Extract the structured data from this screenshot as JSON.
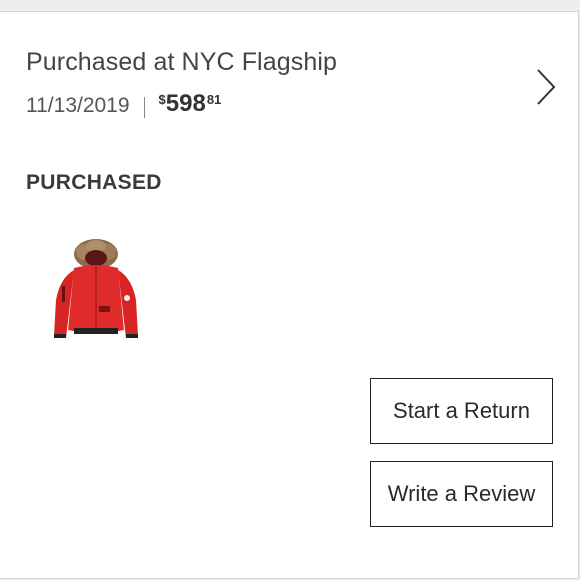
{
  "order": {
    "title": "Purchased at NYC Flagship",
    "date": "11/13/2019",
    "price": {
      "currency": "$",
      "whole": "598",
      "cents": "81"
    }
  },
  "section": {
    "label": "PURCHASED"
  },
  "product": {
    "image": "red-parka-jacket",
    "color": "#e02b2b"
  },
  "actions": {
    "return_label": "Start a Return",
    "review_label": "Write a Review"
  },
  "icons": {
    "next": "chevron-right-icon"
  }
}
